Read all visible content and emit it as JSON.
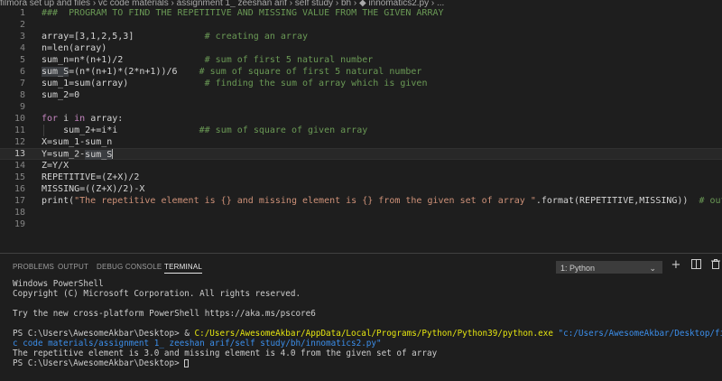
{
  "breadcrumb": "filmora set up and files  › vc code materials  › assignment 1_ zeeshan arif  › self study  › bh  › ◆ innomatics2.py  › ...",
  "editor": {
    "current_line": 13,
    "lines": [
      {
        "n": "1",
        "parts": [
          {
            "t": "###  PROGRAM TO FIND THE REPETITIVE AND MISSING VALUE FROM THE GIVEN ARRAY",
            "c": "comment"
          }
        ]
      },
      {
        "n": "2",
        "parts": []
      },
      {
        "n": "3",
        "parts": [
          {
            "t": "array=[3,1,2,5,3]             ",
            "c": ""
          },
          {
            "t": "# creating an array",
            "c": "comment"
          }
        ]
      },
      {
        "n": "4",
        "parts": [
          {
            "t": "n=len(array)",
            "c": ""
          }
        ]
      },
      {
        "n": "5",
        "parts": [
          {
            "t": "sum_n=n*(n+1)/2               ",
            "c": ""
          },
          {
            "t": "# sum of first 5 natural number",
            "c": "comment"
          }
        ]
      },
      {
        "n": "6",
        "parts": [
          {
            "t": "sum_S",
            "c": "sel"
          },
          {
            "t": "=(n*(n+1)*(2*n+1))/6    ",
            "c": ""
          },
          {
            "t": "# sum of square of first 5 natural number",
            "c": "comment"
          }
        ]
      },
      {
        "n": "7",
        "parts": [
          {
            "t": "sum_1=sum(array)              ",
            "c": ""
          },
          {
            "t": "# finding the sum of array which is given",
            "c": "comment"
          }
        ]
      },
      {
        "n": "8",
        "parts": [
          {
            "t": "sum_2=0",
            "c": ""
          }
        ]
      },
      {
        "n": "9",
        "parts": []
      },
      {
        "n": "10",
        "parts": [
          {
            "t": "for",
            "c": "kw"
          },
          {
            "t": " i ",
            "c": ""
          },
          {
            "t": "in",
            "c": "kw"
          },
          {
            "t": " array:",
            "c": ""
          }
        ]
      },
      {
        "n": "11",
        "parts": [
          {
            "t": "    sum_2+=i*i               ",
            "c": ""
          },
          {
            "t": "## sum of square of given array",
            "c": "comment"
          }
        ],
        "guide": true
      },
      {
        "n": "12",
        "parts": [
          {
            "t": "X=sum_1-sum_n",
            "c": ""
          }
        ]
      },
      {
        "n": "13",
        "parts": [
          {
            "t": "Y=sum_2-",
            "c": ""
          },
          {
            "t": "sum_S",
            "c": "sel"
          }
        ],
        "cursor": true
      },
      {
        "n": "14",
        "parts": [
          {
            "t": "Z=Y/X",
            "c": ""
          }
        ]
      },
      {
        "n": "15",
        "parts": [
          {
            "t": "REPETITIVE=(Z+X)/2",
            "c": ""
          }
        ]
      },
      {
        "n": "16",
        "parts": [
          {
            "t": "MISSING=((Z+X)/2)-X",
            "c": ""
          }
        ]
      },
      {
        "n": "17",
        "parts": [
          {
            "t": "print(",
            "c": ""
          },
          {
            "t": "\"The repetitive element is {} and missing element is {} from the given set of array \"",
            "c": "str"
          },
          {
            "t": ".format(REPETITIVE,MISSING))  ",
            "c": ""
          },
          {
            "t": "# output",
            "c": "comment"
          }
        ]
      },
      {
        "n": "18",
        "parts": []
      },
      {
        "n": "19",
        "parts": []
      }
    ]
  },
  "panel": {
    "tabs": [
      "PROBLEMS",
      "OUTPUT",
      "DEBUG CONSOLE",
      "TERMINAL"
    ],
    "active_tab": "TERMINAL",
    "terminal_select": "1: Python",
    "icons": [
      "chevron-down-icon",
      "plus-icon",
      "split-icon",
      "trash-icon"
    ]
  },
  "terminal": {
    "lines": [
      [
        {
          "t": "Windows PowerShell",
          "c": ""
        }
      ],
      [
        {
          "t": "Copyright (C) Microsoft Corporation. All rights reserved.",
          "c": ""
        }
      ],
      [],
      [
        {
          "t": "Try the new cross-platform PowerShell https://aka.ms/pscore6",
          "c": ""
        }
      ],
      [],
      [
        {
          "t": "PS C:\\Users\\AwesomeAkbar\\Desktop> ",
          "c": ""
        },
        {
          "t": "& ",
          "c": ""
        },
        {
          "t": "C:/Users/AwesomeAkbar/AppData/Local/Programs/Python/Python39/python.exe",
          "c": "t-yellow"
        },
        {
          "t": " \"c:/Users/AwesomeAkbar/Desktop/filmora set up and",
          "c": "t-blue"
        }
      ],
      [
        {
          "t": "c code materials/assignment 1_ zeeshan arif/self study/bh/innomatics2.py\"",
          "c": "t-blue"
        }
      ],
      [
        {
          "t": "The repetitive element is 3.0 and missing element is 4.0 from the given set of array",
          "c": ""
        }
      ],
      [
        {
          "t": "PS C:\\Users\\AwesomeAkbar\\Desktop> ",
          "c": ""
        }
      ]
    ]
  }
}
